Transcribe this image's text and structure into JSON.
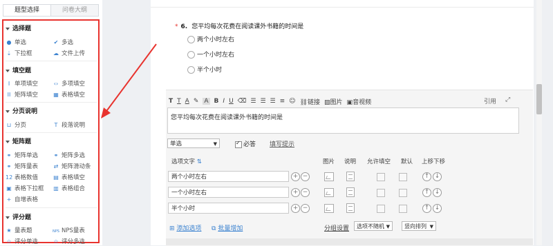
{
  "left_panel": {
    "tabs": [
      "题型选择",
      "问卷大纲"
    ],
    "sections": [
      {
        "title": "选择题",
        "items": [
          "单选",
          "多选",
          "下拉框",
          "文件上传"
        ]
      },
      {
        "title": "填空题",
        "items": [
          "单项填空",
          "多项填空",
          "矩阵填空",
          "表格填空"
        ]
      },
      {
        "title": "分页说明",
        "items": [
          "分页",
          "段落说明"
        ]
      },
      {
        "title": "矩阵题",
        "items": [
          "矩阵单选",
          "矩阵多选",
          "矩阵量表",
          "矩阵滑动条",
          "表格数值",
          "表格填空",
          "表格下拉框",
          "表格组合",
          "自增表格"
        ]
      },
      {
        "title": "评分题",
        "items": [
          "量表题",
          "NPS量表",
          "评分单选",
          "评分多选"
        ]
      }
    ]
  },
  "question": {
    "required_mark": "*",
    "number": "6.",
    "title": "您平均每次花费在阅读课外书籍的时间是",
    "options": [
      "两个小时左右",
      "一个小时左右",
      "半个小时"
    ]
  },
  "editor": {
    "toolbar": [
      "T",
      "T",
      "A",
      "A",
      "B",
      "I",
      "U",
      "链接",
      "图片",
      "音视频"
    ],
    "toolbar_right": "引用",
    "text": "您平均每次花费在阅读课外书籍的时间是",
    "type_select": "单选",
    "required_label": "必答",
    "required_checked": true,
    "hint_link": "填写提示",
    "columns": [
      "选项文字",
      "图片",
      "说明",
      "允许填空",
      "默认",
      "上移下移"
    ],
    "option_rows": [
      "两个小时左右",
      "一个小时左右",
      "半个小时"
    ],
    "add_option": "添加选项",
    "batch_add": "批量增加",
    "group_settings": "分组设置",
    "option_select": "选项不随机",
    "order_select": "竖向排列"
  },
  "colors": {
    "accent": "#3b82d0",
    "highlight": "#e8332e"
  }
}
